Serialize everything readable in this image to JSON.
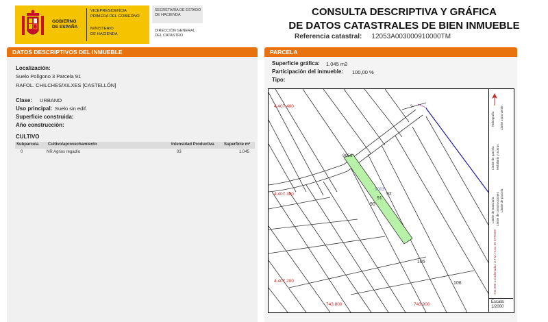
{
  "header": {
    "gov_line1": "GOBIERNO",
    "gov_line2": "DE ESPAÑA",
    "vice_line1": "VICEPRESIDENCIA",
    "vice_line2": "PRIMERA DEL GOBIERNO",
    "min_line1": "MINISTERIO",
    "min_line2": "DE HACIENDA",
    "sec_line1": "SECRETARÍA DE ESTADO",
    "sec_line2": "DE HACIENDA",
    "dir_line1": "DIRECCIÓN GENERAL",
    "dir_line2": "DEL CATASTRO",
    "title_line1": "CONSULTA DESCRIPTIVA Y GRÁFICA",
    "title_line2": "DE DATOS CATASTRALES DE BIEN INMUEBLE",
    "ref_label": "Referencia catastral:",
    "ref_value": "12053A003000910000TM"
  },
  "left": {
    "section_title": "DATOS DESCRIPTIVOS DEL INMUEBLE",
    "localizacion_label": "Localización:",
    "loc_line1": "Suelo Polígono 3 Parcela 91",
    "loc_line2": "RAFOL. CHILCHES/XILXES [CASTELLÓN]",
    "clase_label": "Clase:",
    "clase_value": "URBANO",
    "uso_label": "Uso principal:",
    "uso_value": "Suelo sin edif.",
    "sup_label": "Superficie construida:",
    "anio_label": "Año construcción:",
    "cultivo_title": "CULTIVO",
    "cultivo_headers": [
      "Subparcela",
      "Cultivo/aprovechamiento",
      "Intensidad Productiva",
      "Superficie m²"
    ],
    "cultivo_row": [
      "0",
      "NR Agrios regadío",
      "03",
      "1.045"
    ]
  },
  "right": {
    "section_title": "PARCELA",
    "sup_grafica_label": "Superficie gráfica:",
    "sup_grafica_value": "1.045 m2",
    "particip_label": "Participación del inmueble:",
    "particip_value": "100,00 %",
    "tipo_label": "Tipo:",
    "map_labels": {
      "y1": "4.407.400",
      "y2": "4.407.300",
      "y3": "4.407.200",
      "x1": "743.800",
      "x2": "743.900",
      "p9": "9",
      "p9056": "9056",
      "p9003": "9003",
      "p91": "91",
      "p92": "92",
      "p90": "90",
      "p105": "105",
      "p106": "106"
    },
    "legend": [
      "Límite de parcela",
      "Mobiliario y aceras",
      "Límite zona verde",
      "Hidrografía",
      "Límite de manzana",
      "Límite de construcciones",
      "Límite de parcela",
      "743.000 Coordenadas U.T.M. Huso 30 ETRS89"
    ],
    "scale_label": "Escala:",
    "scale_value": "1/2000"
  },
  "colors": {
    "accent": "#e8730e",
    "logo_yellow": "#f5c400",
    "parcel_fill": "#b8f2a8",
    "coord_red": "#c0302a"
  }
}
